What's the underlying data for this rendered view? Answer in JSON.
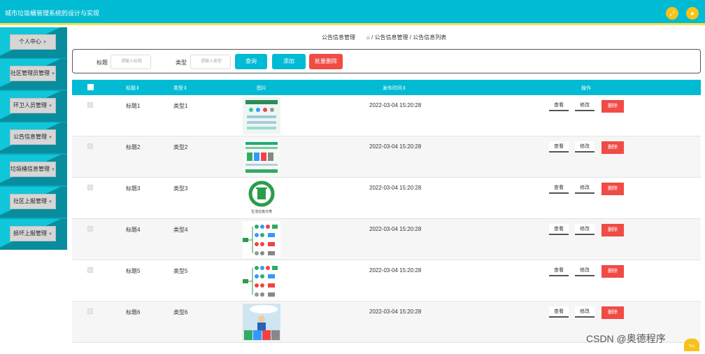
{
  "app": {
    "title": "城市垃圾桶管理系统的设计与实现"
  },
  "topbar": {
    "icons": [
      "fullscreen-icon",
      "user-icon"
    ],
    "accent": "#00bbd3",
    "border": "#f6e14a"
  },
  "sidebar": {
    "items": [
      {
        "label": "个人中心",
        "icon": "chevron-down-icon"
      },
      {
        "label": "社区管理员管理",
        "icon": "chevron-down-icon"
      },
      {
        "label": "环卫人员管理",
        "icon": "chevron-down-icon"
      },
      {
        "label": "公告信息管理",
        "icon": "chevron-down-icon"
      },
      {
        "label": "垃圾桶信息管理",
        "icon": "chevron-down-icon"
      },
      {
        "label": "社区上报管理",
        "icon": "chevron-down-icon"
      },
      {
        "label": "损坏上报管理",
        "icon": "chevron-down-icon"
      }
    ]
  },
  "breadcrumb": {
    "page": "公告信息管理",
    "path": "/ 公告信息管理 / 公告信息列表"
  },
  "search": {
    "title_label": "标题",
    "title_placeholder": "请输入标题",
    "type_label": "类型",
    "type_placeholder": "请输入类型",
    "query_label": "查询",
    "add_label": "添加",
    "batch_delete_label": "批量删除"
  },
  "table": {
    "headers": {
      "title": "标题",
      "type": "类型",
      "image": "图片",
      "publish_time": "发布时间",
      "actions": "操作"
    },
    "action_labels": {
      "view": "查看",
      "edit": "修改",
      "delete": "删除"
    },
    "rows": [
      {
        "title": "标题1",
        "type": "类型1",
        "time": "2022-03-04 15:20:28"
      },
      {
        "title": "标题2",
        "type": "类型2",
        "time": "2022-03-04 15:20:28"
      },
      {
        "title": "标题3",
        "type": "类型3",
        "time": "2022-03-04 15:20:28",
        "image_caption": "生活垃圾分类"
      },
      {
        "title": "标题4",
        "type": "类型4",
        "time": "2022-03-04 15:20:28"
      },
      {
        "title": "标题5",
        "type": "类型5",
        "time": "2022-03-04 15:20:28"
      },
      {
        "title": "标题6",
        "type": "类型6",
        "time": "2022-03-04 15:20:28"
      }
    ]
  },
  "footer": {
    "watermark": "CSDN @奥德程序",
    "top_label": "Top"
  }
}
